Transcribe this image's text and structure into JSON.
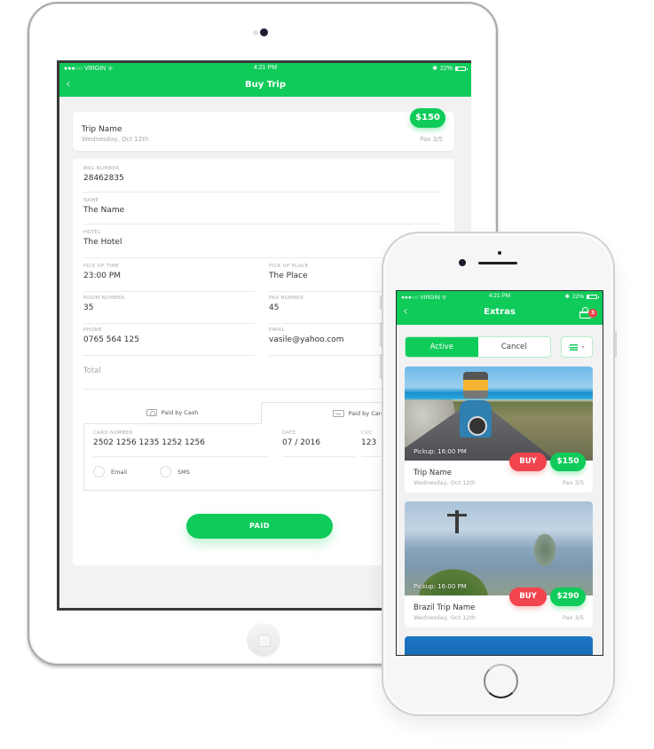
{
  "status_bar": {
    "carrier": "●●●○○ VIRGIN",
    "wifi_icon": "wifi-icon",
    "time": "4:21 PM",
    "bluetooth_icon": "bluetooth-icon",
    "battery": "22%"
  },
  "colors": {
    "accent": "#0fcb5a",
    "buy": "#f0454d",
    "background": "#f2f2f2"
  },
  "ipad": {
    "nav": {
      "back_icon": "‹",
      "title": "Buy Trip"
    },
    "trip": {
      "name": "Trip Name",
      "date": "Wednesday, Oct 12th",
      "price": "$150",
      "pax": "Pax 3/5"
    },
    "form": {
      "bkg_number": {
        "label": "BKG NUMBER",
        "value": "28462835"
      },
      "name": {
        "label": "NAME",
        "value": "The Name"
      },
      "hotel": {
        "label": "HOTEL",
        "value": "The Hotel"
      },
      "pickup_time": {
        "label": "PICK UP TIME",
        "value": "23:00 PM"
      },
      "pickup_place": {
        "label": "PICK UP PLACE",
        "value": "The Place"
      },
      "room_number": {
        "label": "ROOM NUMBER",
        "value": "35"
      },
      "pax_number": {
        "label": "PAX NUMBER",
        "value": "45"
      },
      "phone": {
        "label": "PHONE",
        "value": "0765 564 125"
      },
      "email": {
        "label": "EMAIL",
        "value": "vasile@yahoo.com"
      },
      "total_placeholder": "Total"
    },
    "payment_tabs": [
      {
        "label": "Paid by Cash",
        "icon": "cash-icon",
        "selected": false
      },
      {
        "label": "Paid by Card",
        "icon": "credit-card-icon",
        "selected": true
      }
    ],
    "card": {
      "card_number": {
        "label": "CARD NUMBER",
        "value": "2502 1256 1235 1252 1256"
      },
      "date": {
        "label": "DATE",
        "value": "07 / 2016"
      },
      "cvc": {
        "label": "CVC",
        "value": "123"
      }
    },
    "receipt_options": [
      {
        "label": "Email",
        "checked": false
      },
      {
        "label": "SMS",
        "checked": false
      }
    ],
    "paid_button": "PAID"
  },
  "iphone": {
    "nav": {
      "back_icon": "‹",
      "title": "Extras",
      "cart_icon": "basket-icon",
      "cart_count": "3"
    },
    "segments": [
      {
        "label": "Active",
        "selected": true
      },
      {
        "label": "Cancel",
        "selected": false
      }
    ],
    "view_toggle_icon": "list-view-icon",
    "extras": [
      {
        "pickup": "Pickup: 16:00 PM",
        "name": "Trip Name",
        "date": "Wednesday, Oct 12th",
        "buy": "BUY",
        "price": "$150",
        "pax": "Pax 3/5"
      },
      {
        "pickup": "Pickup: 16:00 PM",
        "name": "Brazil Trip Name",
        "date": "Wednesday, Oct 12th",
        "buy": "BUY",
        "price": "$290",
        "pax": "Pax 3/5"
      }
    ]
  }
}
